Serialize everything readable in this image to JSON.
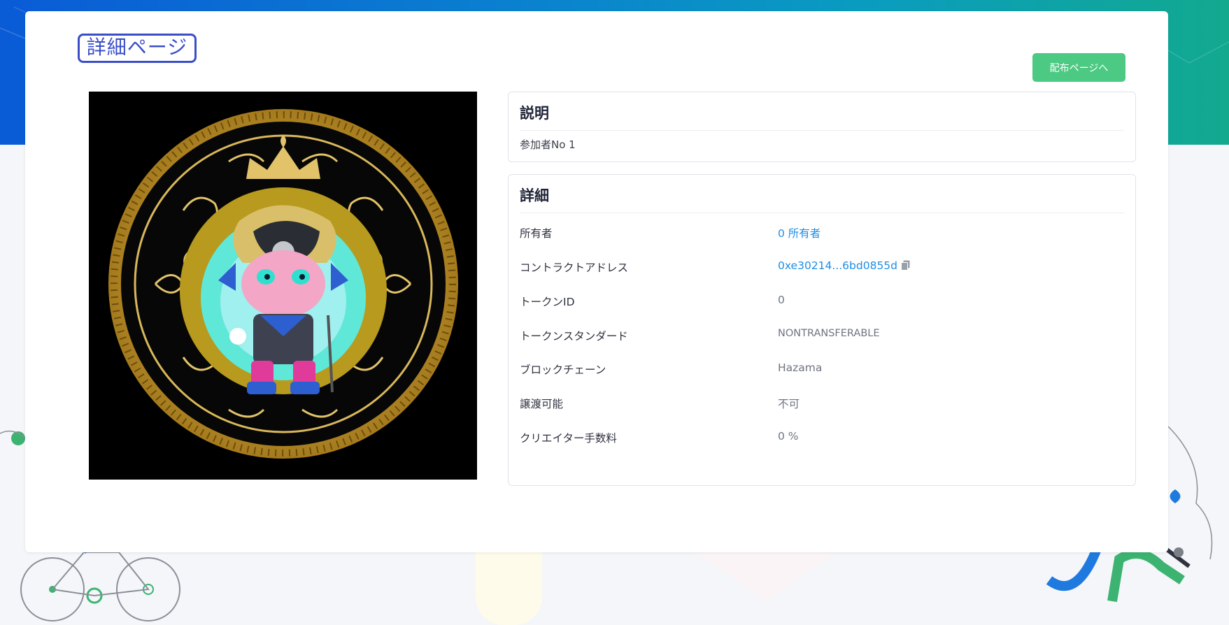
{
  "page": {
    "title": "詳細ページ",
    "distribution_button": "配布ページへ"
  },
  "description": {
    "heading": "説明",
    "text": "参加者No 1"
  },
  "details": {
    "heading": "詳細",
    "rows": [
      {
        "label": "所有者",
        "value": "0 所有者"
      },
      {
        "label": "コントラクトアドレス",
        "value": "0xe30214...6bd0855d"
      },
      {
        "label": "トークンID",
        "value": "0"
      },
      {
        "label": "トークンスタンダード",
        "value": "NONTRANSFERABLE"
      },
      {
        "label": "ブロックチェーン",
        "value": "Hazama"
      },
      {
        "label": "譲渡可能",
        "value": "不可"
      },
      {
        "label": "クリエイター手数料",
        "value": "0 %"
      }
    ]
  },
  "icons": {
    "copy": "copy-icon",
    "nft": "nft-coin-image"
  },
  "colors": {
    "accent_green": "#4cc982",
    "link_blue": "#1f8ee6",
    "title_border": "#3a4ec9",
    "coin_gold": "#c9a227"
  }
}
